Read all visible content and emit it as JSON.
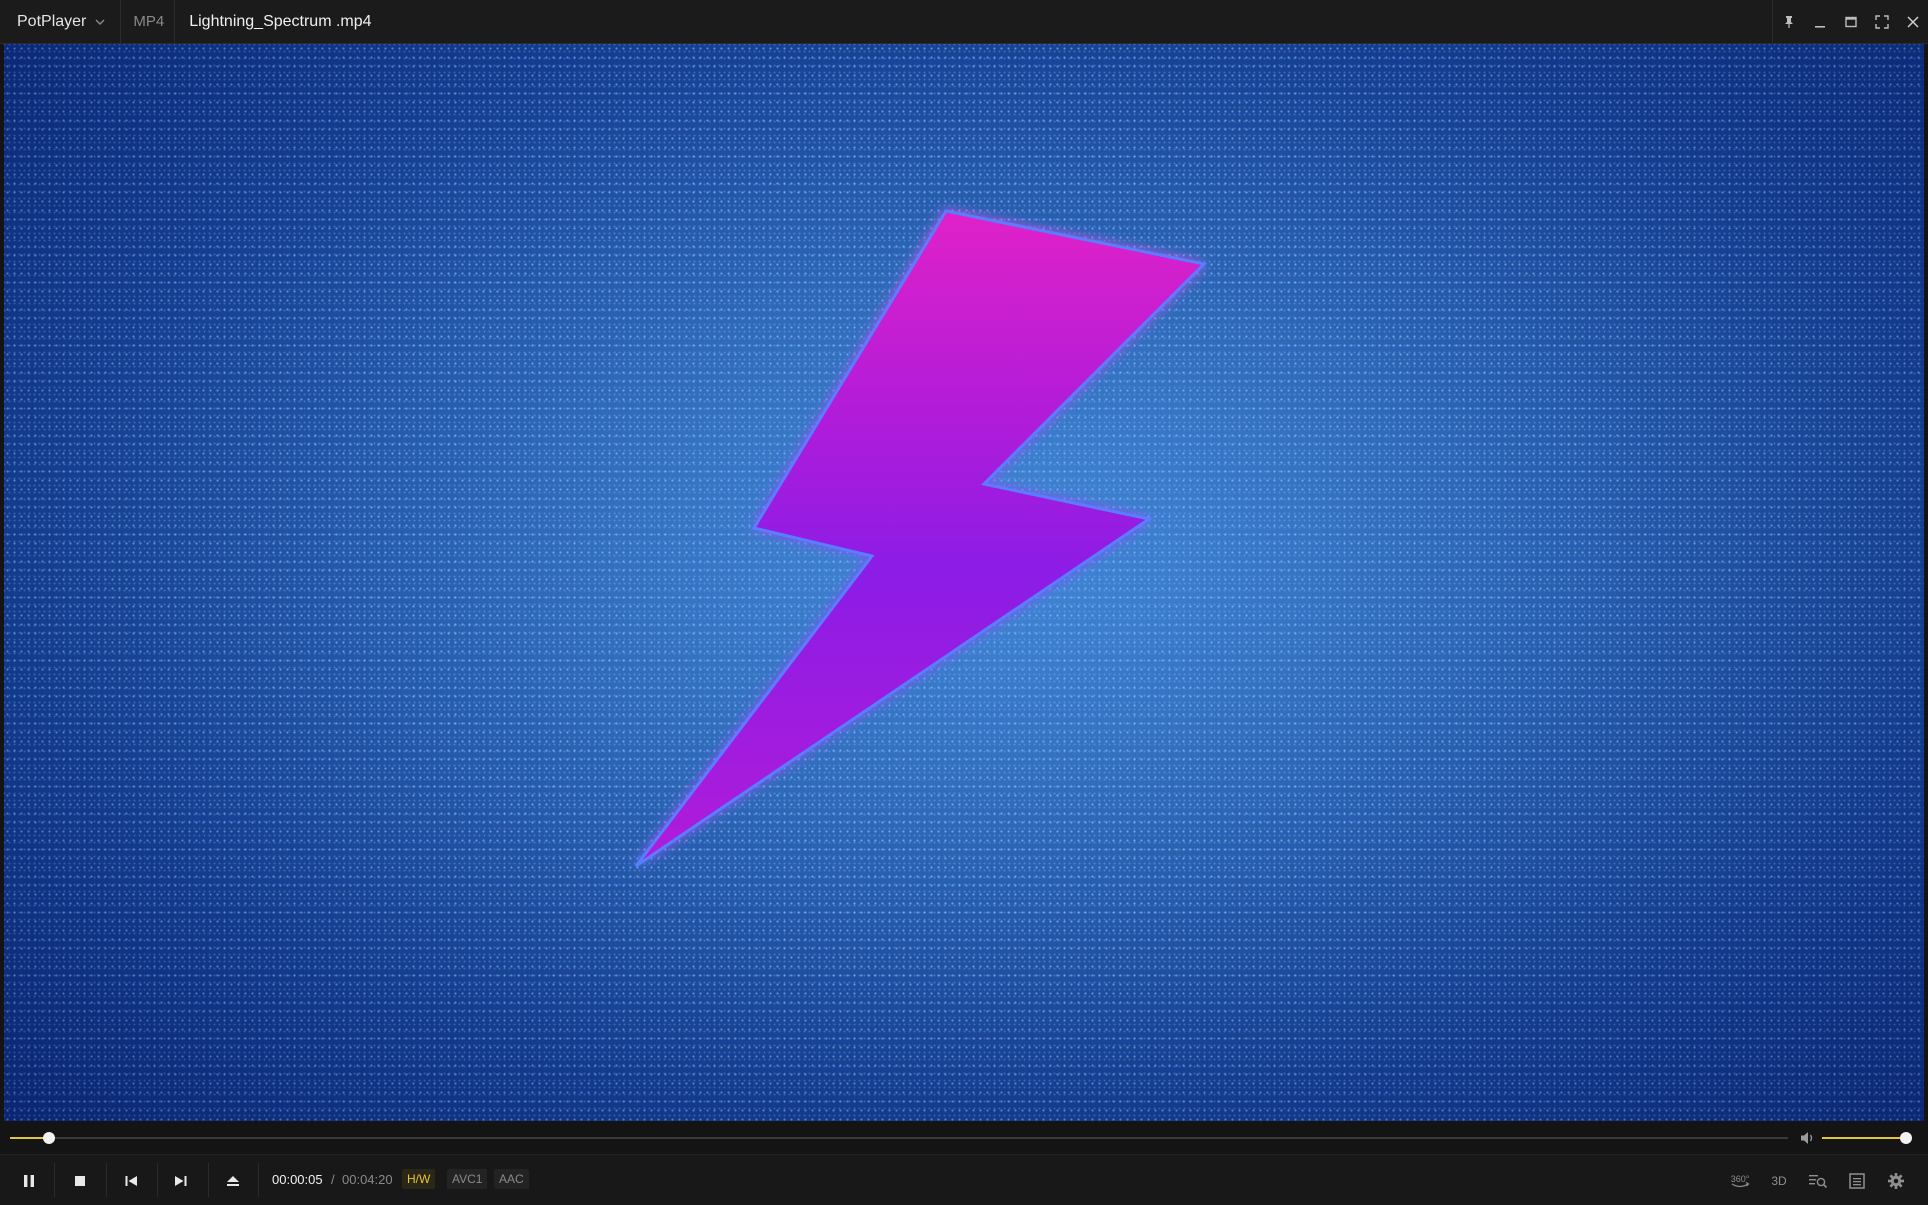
{
  "window": {
    "app_name": "PotPlayer",
    "format": "MP4",
    "file_name": "Lightning_Spectrum .mp4",
    "controls": [
      "pin-icon",
      "minimize-icon",
      "maximize-icon",
      "fullscreen-icon",
      "close-icon"
    ]
  },
  "video": {
    "subject_colors": {
      "bolt_top": "#e020c8",
      "bolt_bottom": "#6a1ee0",
      "background": "#1e55b0"
    }
  },
  "playback": {
    "current_time": "00:00:05",
    "separator": "/",
    "duration": "00:04:20",
    "progress_fraction": 0.022,
    "volume_fraction": 1.0,
    "state": "playing"
  },
  "badges": {
    "hw": "H/W",
    "video_codec": "AVC1",
    "audio_codec": "AAC"
  },
  "right_tools": {
    "vr_label": "360°",
    "stereo_label": "3D"
  },
  "colors": {
    "accent": "#e3c33b",
    "bar_bg": "#181818",
    "titlebar_bg": "#1b1b1b"
  }
}
